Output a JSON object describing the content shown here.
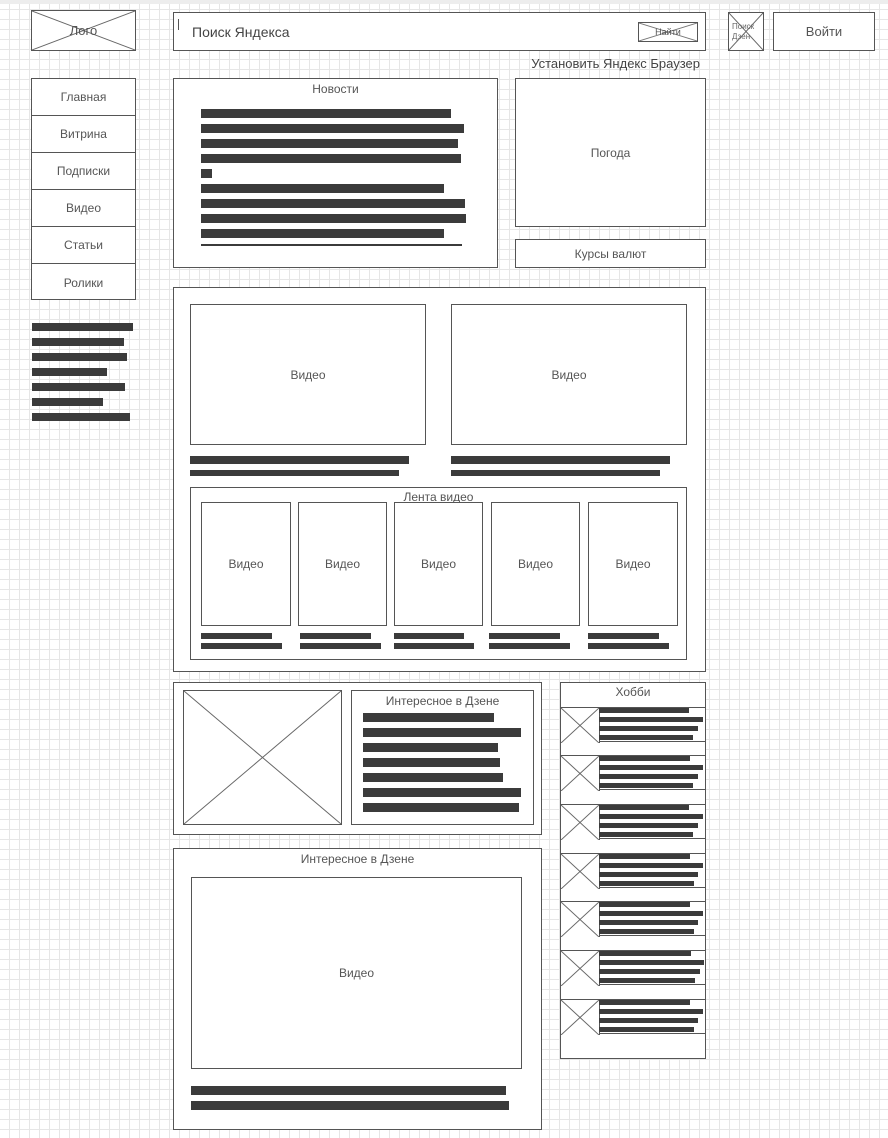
{
  "header": {
    "logo": "Лого",
    "search_placeholder": "Поиск Яндекса",
    "search_button": "Найти",
    "dzen_search": "Поиск Дзен",
    "login_button": "Войти",
    "install_browser": "Установить Яндекс Браузер"
  },
  "nav": {
    "items": [
      "Главная",
      "Витрина",
      "Подписки",
      "Видео",
      "Статьи",
      "Ролики"
    ]
  },
  "news": {
    "title": "Новости"
  },
  "weather": {
    "label": "Погода"
  },
  "currency": {
    "label": "Курсы валют"
  },
  "videos": {
    "main": [
      "Видео",
      "Видео"
    ],
    "feed_title": "Лента видео",
    "feed": [
      "Видео",
      "Видео",
      "Видео",
      "Видео",
      "Видео"
    ]
  },
  "dzen": {
    "title_small": "Интересное в Дзене",
    "title_large": "Интересное в Дзене",
    "video": "Видео"
  },
  "hobby": {
    "title": "Хобби"
  }
}
